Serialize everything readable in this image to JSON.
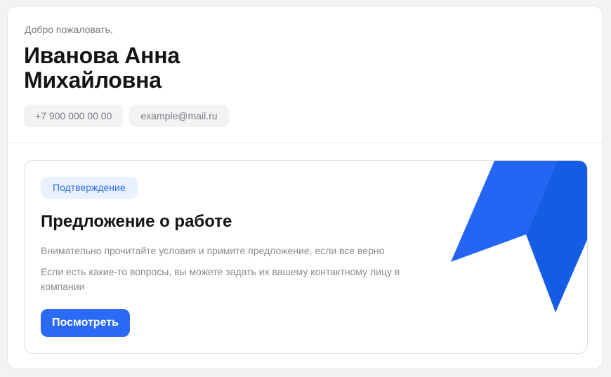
{
  "profile": {
    "greeting": "Добро пожаловать,",
    "full_name": "Иванова Анна Михайловна",
    "phone": "+7 900 000 00 00",
    "email": "example@mail.ru"
  },
  "offer": {
    "badge": "Подтверждение",
    "title": "Предложение о работе",
    "description_1": "Внимательно прочитайте условия и примите предложение, если все верно",
    "description_2": "Если есть какие-то вопросы, вы можете задать их вашему контактному лицу в компании",
    "button_label": "Посмотреть"
  },
  "colors": {
    "accent": "#2b6af5",
    "decor_light": "#2465f3",
    "decor_dark": "#145ce3",
    "badge_bg": "#e9f1fe",
    "badge_text": "#2f6fe6"
  },
  "icons": {
    "offer_decoration": "blue-ribbon-shape"
  }
}
